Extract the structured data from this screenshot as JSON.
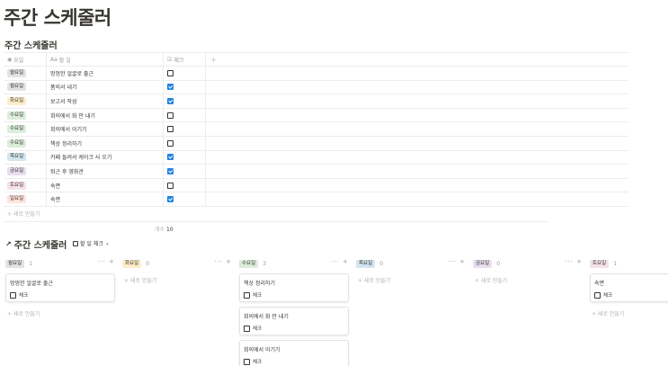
{
  "page_title": "주간 스케줄러",
  "table_title": "주간 스케줄러",
  "columns": {
    "day": "요일",
    "task": "할 일",
    "check": "체크",
    "add": "+"
  },
  "tag_colors": {
    "월요일": "#e3e2e0",
    "화요일": "#fdecc8",
    "수요일": "#dbeddb",
    "목요일": "#d3e5ef",
    "금요일": "#e8deee",
    "토요일": "#f5e0e9",
    "일요일": "#ffe2dd"
  },
  "rows": [
    {
      "day": "월요일",
      "task": "멍멍한 얼굴로 출근",
      "checked": false
    },
    {
      "day": "월요일",
      "task": "품의서 내기",
      "checked": true
    },
    {
      "day": "화요일",
      "task": "보고서 작성",
      "checked": true
    },
    {
      "day": "수요일",
      "task": "회의에서 화 안 내기",
      "checked": false
    },
    {
      "day": "수요일",
      "task": "회의에서 이기기",
      "checked": false
    },
    {
      "day": "수요일",
      "task": "책상 정리하기",
      "checked": false
    },
    {
      "day": "목요일",
      "task": "카페 들려서 케이크 사 오기",
      "checked": true
    },
    {
      "day": "금요일",
      "task": "퇴근 후 영화관",
      "checked": true
    },
    {
      "day": "토요일",
      "task": "숙면",
      "checked": false
    },
    {
      "day": "일요일",
      "task": "숙면",
      "checked": true
    }
  ],
  "new_row_label": "+ 새로 만들기",
  "count_label": "개수",
  "count_value": "10",
  "board": {
    "title": "주간 스케줄러",
    "view_label": "할 일 체크",
    "new_label": "+ 새로 만들기",
    "check_label": "체크",
    "groups": [
      {
        "name": "월요일",
        "count": "1",
        "cards": [
          "멍멍한 얼굴로 출근"
        ]
      },
      {
        "name": "화요일",
        "count": "0",
        "cards": []
      },
      {
        "name": "수요일",
        "count": "3",
        "cards": [
          "책상 정리하기",
          "회의에서 화 안 내기",
          "회의에서 이기기"
        ]
      },
      {
        "name": "목요일",
        "count": "0",
        "cards": []
      },
      {
        "name": "금요일",
        "count": "0",
        "cards": []
      },
      {
        "name": "토요일",
        "count": "1",
        "cards": [
          "숙면"
        ]
      }
    ]
  }
}
